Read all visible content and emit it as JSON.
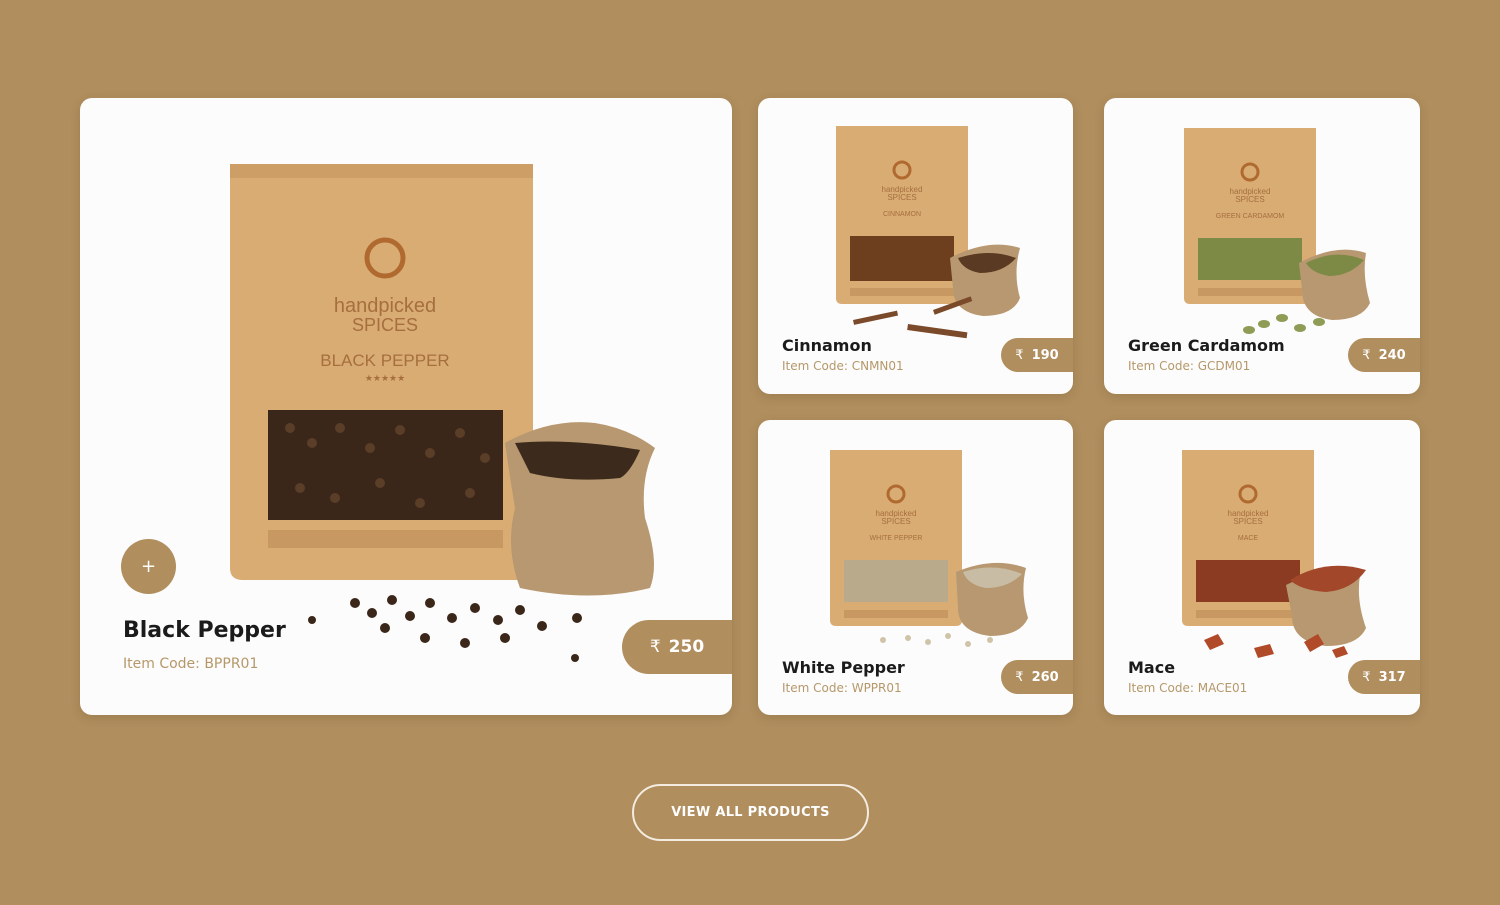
{
  "featured": {
    "name": "Black Pepper",
    "code": "Item Code: BPPR01",
    "price": "250",
    "currency": "₹",
    "add_label": "+",
    "pack": {
      "brand_line1": "handpicked",
      "brand_line2": "SPICES",
      "label": "BLACK PEPPER",
      "stars": "★★★★★"
    }
  },
  "products": [
    {
      "name": "Cinnamon",
      "code": "Item Code: CNMN01",
      "price": "190",
      "currency": "₹",
      "pack": {
        "brand_line1": "handpicked",
        "brand_line2": "SPICES",
        "label": "CINNAMON",
        "stars": "★★★★★"
      }
    },
    {
      "name": "Green Cardamom",
      "code": "Item Code: GCDM01",
      "price": "240",
      "currency": "₹",
      "pack": {
        "brand_line1": "handpicked",
        "brand_line2": "SPICES",
        "label": "GREEN CARDAMOM",
        "stars": "★★★★★"
      }
    },
    {
      "name": "White Pepper",
      "code": "Item Code: WPPR01",
      "price": "260",
      "currency": "₹",
      "pack": {
        "brand_line1": "handpicked",
        "brand_line2": "SPICES",
        "label": "WHITE PEPPER",
        "stars": "★★★★★"
      }
    },
    {
      "name": "Mace",
      "code": "Item Code: MACE01",
      "price": "317",
      "currency": "₹",
      "pack": {
        "brand_line1": "handpicked",
        "brand_line2": "SPICES",
        "label": "MACE",
        "stars": "★★★★★"
      }
    }
  ],
  "view_all_label": "VIEW ALL PRODUCTS",
  "colors": {
    "background": "#b08e5e",
    "card": "#fdfcfc",
    "accent": "#b08e5e",
    "code_text": "#b5986a",
    "pouch": "#d9ac74"
  }
}
